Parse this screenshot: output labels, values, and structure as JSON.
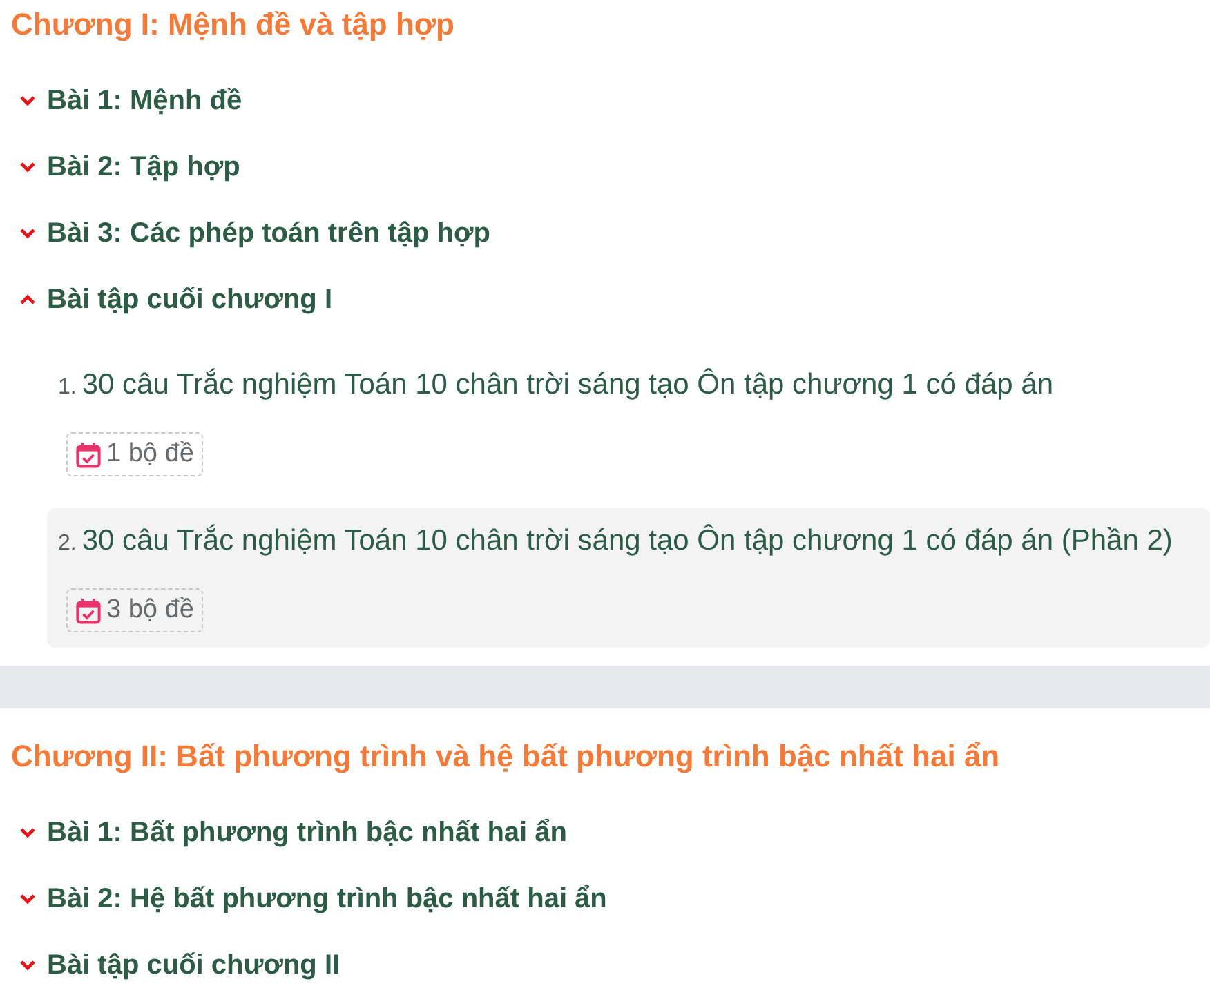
{
  "chapters": [
    {
      "title": "Chương I: Mệnh đề và tập hợp",
      "lessons": [
        {
          "title": "Bài 1: Mệnh đề",
          "expanded": false
        },
        {
          "title": "Bài 2: Tập hợp",
          "expanded": false
        },
        {
          "title": "Bài 3: Các phép toán trên tập hợp",
          "expanded": false
        },
        {
          "title": "Bài tập cuối chương I",
          "expanded": true,
          "items": [
            {
              "number": "1.",
              "title": "30 câu Trắc nghiệm Toán 10 chân trời sáng tạo Ôn tập chương 1 có đáp án",
              "count": "1 bộ đề",
              "highlighted": false
            },
            {
              "number": "2.",
              "title": "30 câu Trắc nghiệm Toán 10 chân trời sáng tạo Ôn tập chương 1 có đáp án (Phần 2)",
              "count": "3 bộ đề",
              "highlighted": true
            }
          ]
        }
      ]
    },
    {
      "title": "Chương II: Bất phương trình và hệ bất phương trình bậc nhất hai ẩn",
      "lessons": [
        {
          "title": "Bài 1: Bất phương trình bậc nhất hai ẩn",
          "expanded": false
        },
        {
          "title": "Bài 2: Hệ bất phương trình bậc nhất hai ẩn",
          "expanded": false
        },
        {
          "title": "Bài tập cuối chương II",
          "expanded": false
        }
      ]
    }
  ]
}
